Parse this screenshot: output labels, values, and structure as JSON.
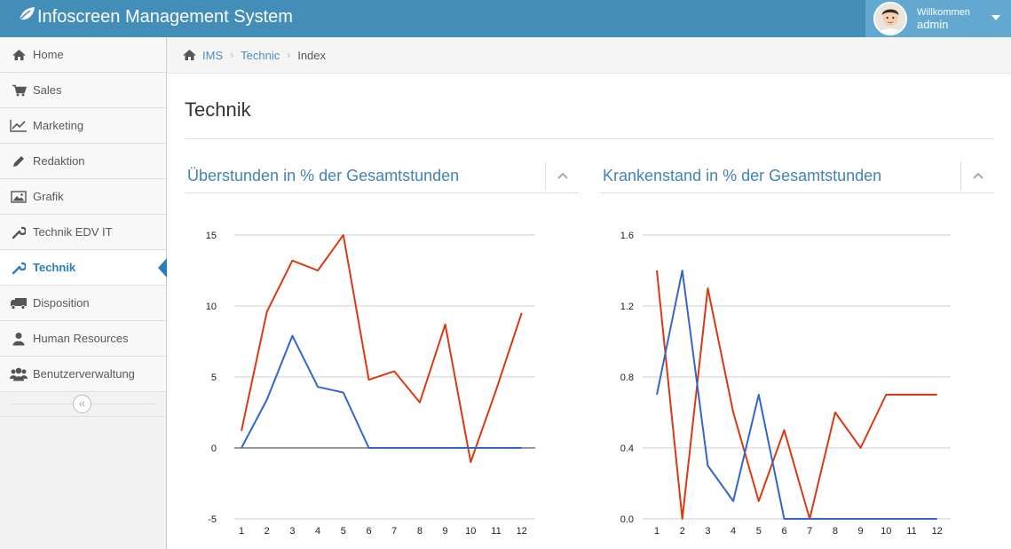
{
  "app": {
    "title": "Infoscreen Management System",
    "brand_icon": "leaf-icon",
    "colors": {
      "navbar": "#438eb9",
      "user_menu": "#62a8d1",
      "active": "#2b7dbc",
      "series_red": "#dc3912",
      "series_blue": "#3366cc"
    }
  },
  "user": {
    "greeting": "Willkommen",
    "name": "admin"
  },
  "sidebar": {
    "items": [
      {
        "label": "Home",
        "icon": "home-icon"
      },
      {
        "label": "Sales",
        "icon": "cart-icon"
      },
      {
        "label": "Marketing",
        "icon": "chart-line-icon"
      },
      {
        "label": "Redaktion",
        "icon": "pencil-icon"
      },
      {
        "label": "Grafik",
        "icon": "picture-icon"
      },
      {
        "label": "Technik EDV IT",
        "icon": "wrench-icon"
      },
      {
        "label": "Technik",
        "icon": "wrench-icon",
        "active": true
      },
      {
        "label": "Disposition",
        "icon": "truck-icon"
      },
      {
        "label": "Human Resources",
        "icon": "user-icon"
      },
      {
        "label": "Benutzerverwaltung",
        "icon": "users-icon"
      }
    ],
    "collapse_glyph": "«"
  },
  "breadcrumb": {
    "items": [
      "IMS",
      "Technic"
    ],
    "current": "Index"
  },
  "page": {
    "title": "Technik"
  },
  "widgets": [
    {
      "title": "Überstunden in % der Gesamtstunden"
    },
    {
      "title": "Krankenstand in % der Gesamtstunden"
    }
  ],
  "chart_data": [
    {
      "type": "line",
      "x": [
        1,
        2,
        3,
        4,
        5,
        6,
        7,
        8,
        9,
        10,
        11,
        12
      ],
      "yticks": [
        -5,
        0,
        5,
        10,
        15
      ],
      "ylim": [
        -5,
        15
      ],
      "grid": true,
      "legend": "none",
      "series": [
        {
          "color": "#dc3912",
          "values": [
            1.2,
            9.6,
            13.2,
            12.5,
            15.0,
            4.8,
            5.4,
            3.2,
            8.7,
            -1.0,
            4.1,
            9.5
          ]
        },
        {
          "color": "#3366cc",
          "values": [
            0.0,
            3.4,
            7.9,
            4.3,
            3.9,
            0.0,
            0.0,
            0.0,
            0.0,
            0.0,
            0.0,
            0.0
          ]
        }
      ]
    },
    {
      "type": "line",
      "x": [
        1,
        2,
        3,
        4,
        5,
        6,
        7,
        8,
        9,
        10,
        11,
        12
      ],
      "yticks": [
        "0.0",
        "0.4",
        "0.8",
        "1.2",
        "1.6"
      ],
      "ylim": [
        0,
        1.6
      ],
      "grid": true,
      "legend": "none",
      "series": [
        {
          "color": "#dc3912",
          "values": [
            1.4,
            0.0,
            1.3,
            0.6,
            0.1,
            0.5,
            0.0,
            0.6,
            0.4,
            0.7,
            0.7,
            0.7
          ]
        },
        {
          "color": "#3366cc",
          "values": [
            0.7,
            1.4,
            0.3,
            0.1,
            0.7,
            0.0,
            0.0,
            0.0,
            0.0,
            0.0,
            0.0,
            0.0
          ]
        }
      ]
    }
  ]
}
